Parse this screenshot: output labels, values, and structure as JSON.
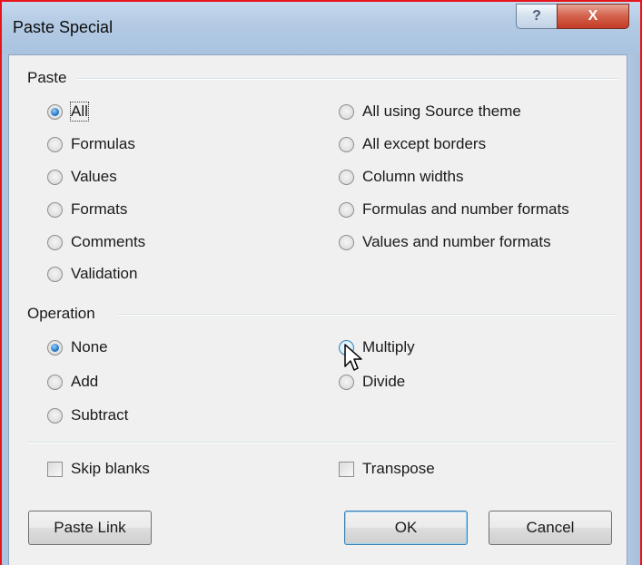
{
  "window": {
    "title": "Paste Special",
    "help_glyph": "?",
    "close_glyph": "X",
    "frame_color": "#e8141b"
  },
  "paste": {
    "label": "Paste",
    "left_options": [
      {
        "label": "All",
        "checked": true
      },
      {
        "label": "Formulas",
        "checked": false
      },
      {
        "label": "Values",
        "checked": false
      },
      {
        "label": "Formats",
        "checked": false
      },
      {
        "label": "Comments",
        "checked": false
      },
      {
        "label": "Validation",
        "checked": false
      }
    ],
    "right_options": [
      {
        "label": "All using Source theme",
        "checked": false
      },
      {
        "label": "All except borders",
        "checked": false
      },
      {
        "label": "Column widths",
        "checked": false
      },
      {
        "label": "Formulas and number formats",
        "checked": false
      },
      {
        "label": "Values and number formats",
        "checked": false
      }
    ]
  },
  "operation": {
    "label": "Operation",
    "left_options": [
      {
        "label": "None",
        "checked": true
      },
      {
        "label": "Add",
        "checked": false
      },
      {
        "label": "Subtract",
        "checked": false
      }
    ],
    "right_options": [
      {
        "label": "Multiply",
        "checked": false,
        "hover": true
      },
      {
        "label": "Divide",
        "checked": false
      }
    ]
  },
  "checkboxes": {
    "skip_blanks": {
      "label": "Skip blanks",
      "checked": false
    },
    "transpose": {
      "label": "Transpose",
      "checked": false
    }
  },
  "buttons": {
    "paste_link": "Paste Link",
    "ok": "OK",
    "cancel": "Cancel"
  },
  "icons": {
    "cursor": "mouse-pointer-icon",
    "help": "help-icon",
    "close": "close-icon"
  }
}
